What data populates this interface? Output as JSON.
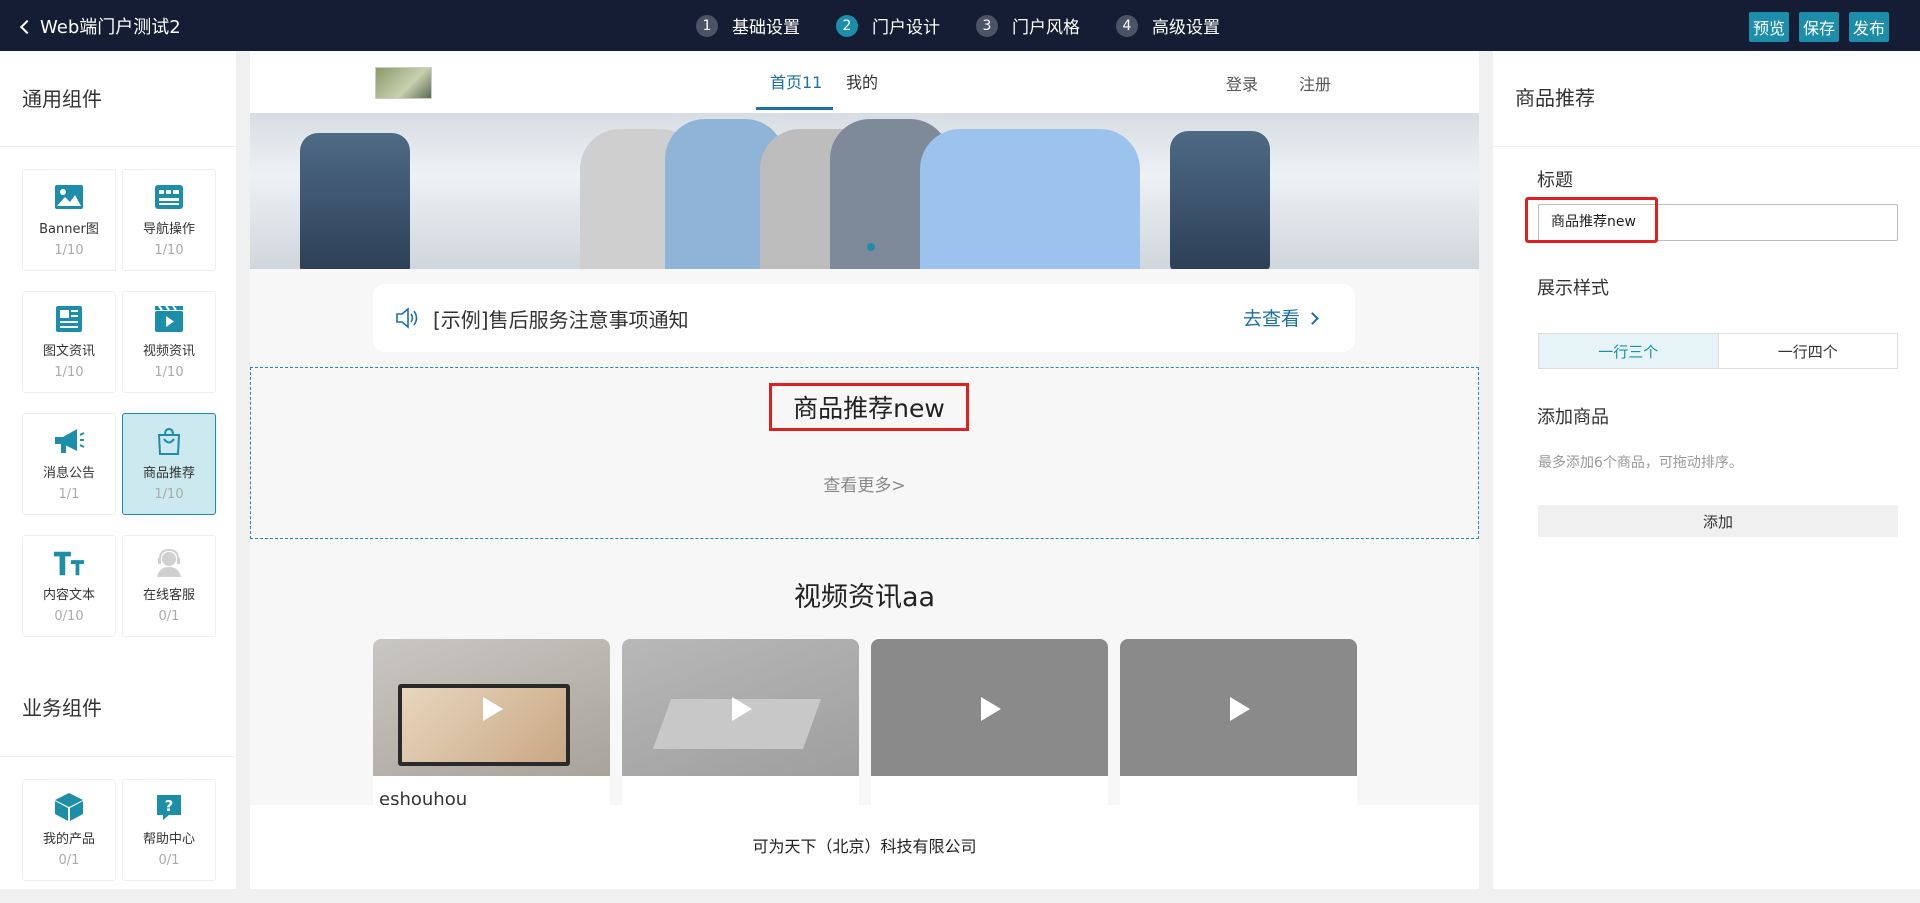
{
  "header": {
    "back_label": "Web端门户测试2",
    "steps": [
      {
        "num": "1",
        "label": "基础设置"
      },
      {
        "num": "2",
        "label": "门户设计"
      },
      {
        "num": "3",
        "label": "门户风格"
      },
      {
        "num": "4",
        "label": "高级设置"
      }
    ],
    "actions": {
      "preview": "预览",
      "save": "保存",
      "publish": "发布"
    }
  },
  "left": {
    "general_title": "通用组件",
    "general": [
      {
        "name": "Banner图",
        "count": "1/10",
        "icon": "image-icon"
      },
      {
        "name": "导航操作",
        "count": "1/10",
        "icon": "navigation-icon"
      },
      {
        "name": "图文资讯",
        "count": "1/10",
        "icon": "article-icon"
      },
      {
        "name": "视频资讯",
        "count": "1/10",
        "icon": "video-icon"
      },
      {
        "name": "消息公告",
        "count": "1/1",
        "icon": "megaphone-icon"
      },
      {
        "name": "商品推荐",
        "count": "1/10",
        "icon": "shopping-bag-icon"
      },
      {
        "name": "内容文本",
        "count": "0/10",
        "icon": "text-icon"
      },
      {
        "name": "在线客服",
        "count": "0/1",
        "icon": "customer-service-icon"
      }
    ],
    "business_title": "业务组件",
    "business": [
      {
        "name": "我的产品",
        "count": "0/1",
        "icon": "box-icon"
      },
      {
        "name": "帮助中心",
        "count": "0/1",
        "icon": "help-icon"
      }
    ]
  },
  "canvas": {
    "nav": {
      "tab_home": "首页11",
      "tab_mine": "我的",
      "login": "登录",
      "register": "注册"
    },
    "notice": {
      "text": "[示例]售后服务注意事项通知",
      "link": "去查看"
    },
    "product": {
      "title": "商品推荐new",
      "more": "查看更多>"
    },
    "video": {
      "title": "视频资讯aa",
      "items": [
        {
          "title": "eshouhou"
        },
        {
          "title": ""
        },
        {
          "title": ""
        },
        {
          "title": ""
        }
      ]
    },
    "footer": "可为天下（北京）科技有限公司"
  },
  "right": {
    "title": "商品推荐",
    "field_title_label": "标题",
    "field_title_value": "商品推荐new",
    "display_label": "展示样式",
    "display_options": [
      "一行三个",
      "一行四个"
    ],
    "add_label": "添加商品",
    "add_hint": "最多添加6个商品，可拖动排序。",
    "add_button": "添加"
  },
  "colors": {
    "accent": "#1c8ea9",
    "topbar": "#141d33",
    "highlight": "#e02020"
  }
}
